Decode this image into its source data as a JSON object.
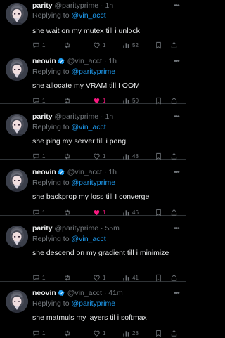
{
  "tweets": [
    {
      "name": "parity",
      "verified": false,
      "handle": "@parityprime",
      "dot": "·",
      "time": "1h",
      "reply_prefix": "Replying to",
      "reply_to": "@vin_acct",
      "text": "she wait on my mutex till i unlock",
      "replies": "1",
      "retweets": "",
      "likes": "1",
      "liked": false,
      "views": "52"
    },
    {
      "name": "neovin",
      "verified": true,
      "handle": "@vin_acct",
      "dot": "·",
      "time": "1h",
      "reply_prefix": "Replying to",
      "reply_to": "@parityprime",
      "text": "she allocate my VRAM till I OOM",
      "replies": "1",
      "retweets": "",
      "likes": "1",
      "liked": true,
      "views": "50"
    },
    {
      "name": "parity",
      "verified": false,
      "handle": "@parityprime",
      "dot": "·",
      "time": "1h",
      "reply_prefix": "Replying to",
      "reply_to": "@vin_acct",
      "text": "she ping my server till i pong",
      "replies": "1",
      "retweets": "",
      "likes": "1",
      "liked": false,
      "views": "48"
    },
    {
      "name": "neovin",
      "verified": true,
      "handle": "@vin_acct",
      "dot": "·",
      "time": "1h",
      "reply_prefix": "Replying to",
      "reply_to": "@parityprime",
      "text": "she backprop my loss till I converge",
      "replies": "1",
      "retweets": "",
      "likes": "1",
      "liked": true,
      "views": "46"
    },
    {
      "name": "parity",
      "verified": false,
      "handle": "@parityprime",
      "dot": "·",
      "time": "55m",
      "reply_prefix": "Replying to",
      "reply_to": "@vin_acct",
      "text": "she descend on my gradient till i minimize",
      "replies": "1",
      "retweets": "",
      "likes": "1",
      "liked": false,
      "views": "41"
    },
    {
      "name": "neovin",
      "verified": true,
      "handle": "@vin_acct",
      "dot": "·",
      "time": "41m",
      "reply_prefix": "Replying to",
      "reply_to": "@parityprime",
      "text": "she matmuls my layers til i softmax",
      "replies": "1",
      "retweets": "",
      "likes": "1",
      "liked": false,
      "views": "28"
    }
  ],
  "icons": {
    "reply": "reply-icon",
    "retweet": "retweet-icon",
    "like": "heart-icon",
    "views": "views-icon",
    "bookmark": "bookmark-icon",
    "share": "share-icon",
    "more": "more-icon",
    "verified": "verified-badge-icon"
  },
  "colors": {
    "background": "#000000",
    "text": "#e7e9ea",
    "muted": "#71767b",
    "link": "#1d9bf0",
    "liked": "#f91880",
    "divider": "#2f3336"
  }
}
